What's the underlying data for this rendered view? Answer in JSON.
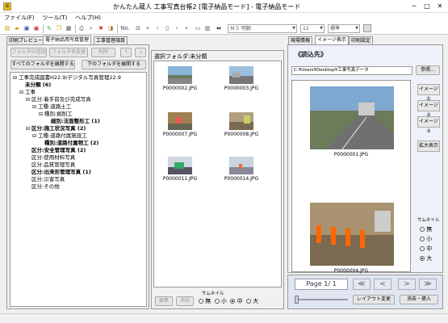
{
  "window": {
    "title": "かんたん蔵人 工事写真台帳2 [電子納品モード] - 電子納品モード",
    "app_icon_label": "版"
  },
  "menu": [
    "ファイル(F)",
    "ツール(T)",
    "ヘルプ(H)"
  ],
  "toolbar": {
    "font_name": "ＭＳ 明朝",
    "font_size": "12",
    "style": "標準",
    "no_label": "No."
  },
  "left_tabs": [
    "印刷プレビュー",
    "電子納品用写真管理",
    "工事管理項目"
  ],
  "left_buttons": {
    "add_folder": "フォルダの追加",
    "rename_folder": "フォルダ名変更",
    "delete": "削除",
    "up": "↑",
    "down": "↓",
    "expand_all": "すべてのフォルダを展開する",
    "expand_below": "下のフォルダを展開する"
  },
  "tree": [
    {
      "text": "工事完成図書H22.9/デジタル写真管理22.9",
      "indent": 0,
      "bold": false,
      "toggle": "⊟"
    },
    {
      "text": "未分類 (6)",
      "indent": 1,
      "bold": true,
      "toggle": ""
    },
    {
      "text": "工事",
      "indent": 1,
      "bold": false,
      "toggle": "⊟"
    },
    {
      "text": "区分:着手前及び完成写真",
      "indent": 2,
      "bold": false,
      "toggle": "⊟"
    },
    {
      "text": "工種:道路土工",
      "indent": 3,
      "bold": false,
      "toggle": "⊟"
    },
    {
      "text": "種別:掘削工",
      "indent": 4,
      "bold": false,
      "toggle": "⊟"
    },
    {
      "text": "細別:法面整形工 (1)",
      "indent": 5,
      "bold": true,
      "toggle": ""
    },
    {
      "text": "区分:施工状況写真 (2)",
      "indent": 2,
      "bold": true,
      "toggle": "⊟"
    },
    {
      "text": "工種:道路付属施設工",
      "indent": 3,
      "bold": false,
      "toggle": "⊟"
    },
    {
      "text": "種別:道路付属物工 (2)",
      "indent": 4,
      "bold": true,
      "toggle": ""
    },
    {
      "text": "区分:安全管理写真 (2)",
      "indent": 2,
      "bold": true,
      "toggle": ""
    },
    {
      "text": "区分:使用材料写真",
      "indent": 2,
      "bold": false,
      "toggle": ""
    },
    {
      "text": "区分:品質管理写真",
      "indent": 2,
      "bold": false,
      "toggle": ""
    },
    {
      "text": "区分:出来形管理写真 (1)",
      "indent": 2,
      "bold": true,
      "toggle": ""
    },
    {
      "text": "区分:災害写真",
      "indent": 2,
      "bold": false,
      "toggle": ""
    },
    {
      "text": "区分:その他",
      "indent": 2,
      "bold": false,
      "toggle": ""
    }
  ],
  "middle": {
    "folder_label": "選択フォルダ:未分類",
    "photos": [
      "P0000002.JPG",
      "P0000003.JPG",
      "P0000007.JPG",
      "P0000008.JPG",
      "P0000011.JPG",
      "P0000014.JPG"
    ],
    "edit_btn": "編集",
    "delete_btn": "消去",
    "thumbnail_label": "サムネイル",
    "sizes": [
      "無",
      "小",
      "中",
      "大"
    ],
    "selected_size": "中"
  },
  "right_tabs": [
    "現場情報",
    "イメージ表示",
    "印刷設定"
  ],
  "right": {
    "read_label": "《読込先》",
    "path": "C:¥Users¥Desktop¥工事写真データ",
    "browse_btn": "参照...",
    "photos": [
      "P0000001.JPG",
      "P0000004.JPG"
    ],
    "image_btns": [
      "イメージ①",
      "イメージ②",
      "イメージ③"
    ],
    "zoom_btn": "拡大表示",
    "thumbnail_label": "サムネイル",
    "sizes": [
      "無",
      "小",
      "中",
      "大"
    ],
    "selected_size": "大",
    "page": "Page 1/ 1",
    "nav": [
      "≪",
      "<",
      ">",
      "≫"
    ],
    "layout_btn": "レイアウト変更",
    "import_btn": "消去・挿入"
  }
}
